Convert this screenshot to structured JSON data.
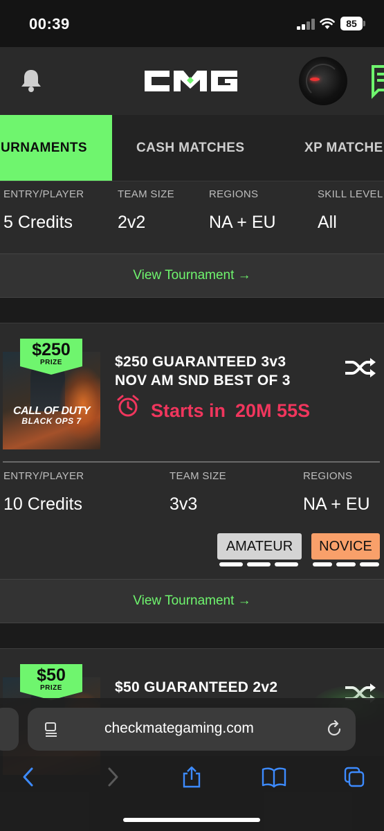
{
  "status_bar": {
    "time": "00:39",
    "battery": "85"
  },
  "header": {
    "logo_text": "CMG"
  },
  "tabs": [
    {
      "label": "URNAMENTS"
    },
    {
      "label": "CASH MATCHES"
    },
    {
      "label": "XP MATCHE"
    }
  ],
  "first_card": {
    "labels": {
      "entry": "ENTRY/PLAYER",
      "team": "TEAM SIZE",
      "regions": "REGIONS",
      "skill": "SKILL LEVEL"
    },
    "values": {
      "entry": "5 Credits",
      "team": "2v2",
      "regions": "NA + EU",
      "skill": "All"
    },
    "view_button": "View Tournament →"
  },
  "second_card": {
    "prize_amount": "$250",
    "prize_label": "PRIZE",
    "game_line1": "CALL OF DUTY",
    "game_line2": "BLACK OPS 7",
    "title_line1": "$250 GUARANTEED 3v3",
    "title_line2": "NOV AM SND BEST OF 3",
    "starts_label": "Starts in",
    "countdown": "20M 55S",
    "labels": {
      "entry": "ENTRY/PLAYER",
      "team": "TEAM SIZE",
      "regions": "REGIONS"
    },
    "values": {
      "entry": "10 Credits",
      "team": "3v3",
      "regions": "NA + EU"
    },
    "skill_badges": [
      {
        "label": "AMATEUR",
        "color": "#d4d4d4"
      },
      {
        "label": "NOVICE",
        "color": "#f9a06a"
      }
    ],
    "view_button": "View Tournament →"
  },
  "third_card": {
    "prize_amount": "$50",
    "prize_label": "PRIZE",
    "title_line1": "$50 GUARANTEED 2v2"
  },
  "browser": {
    "url": "checkmategaming.com"
  },
  "colors": {
    "accent": "#6ff56e",
    "danger": "#f0365d",
    "ios_blue": "#3d8bff"
  },
  "icons": [
    "bell-icon",
    "chat-icon",
    "shuffle-icon",
    "alarm-clock-icon",
    "reader-icon",
    "reload-icon",
    "back-icon",
    "forward-icon",
    "share-icon",
    "bookmarks-icon",
    "tabs-icon"
  ]
}
